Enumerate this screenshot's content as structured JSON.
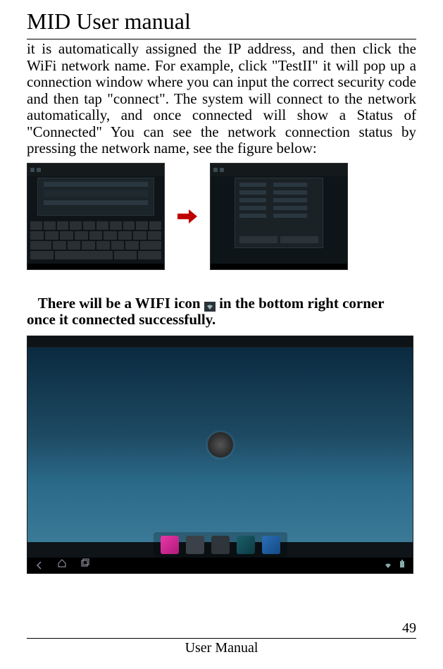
{
  "title": "MID User manual",
  "paragraph": "it is automatically assigned the IP address, and then click the WiFi network name. For example, click \"TestII\" it will pop up a connection window where you can input the correct security code and then tap \"connect\". The system will connect to the network automatically, and once connected will show a Status of \"Connected\" You can see the network connection status by pressing the network name, see the figure below:",
  "bold_before": "There will be a WIFI icon ",
  "bold_after": " in the bottom right corner once it connected successfully.",
  "page_number": "49",
  "footer": "User Manual"
}
